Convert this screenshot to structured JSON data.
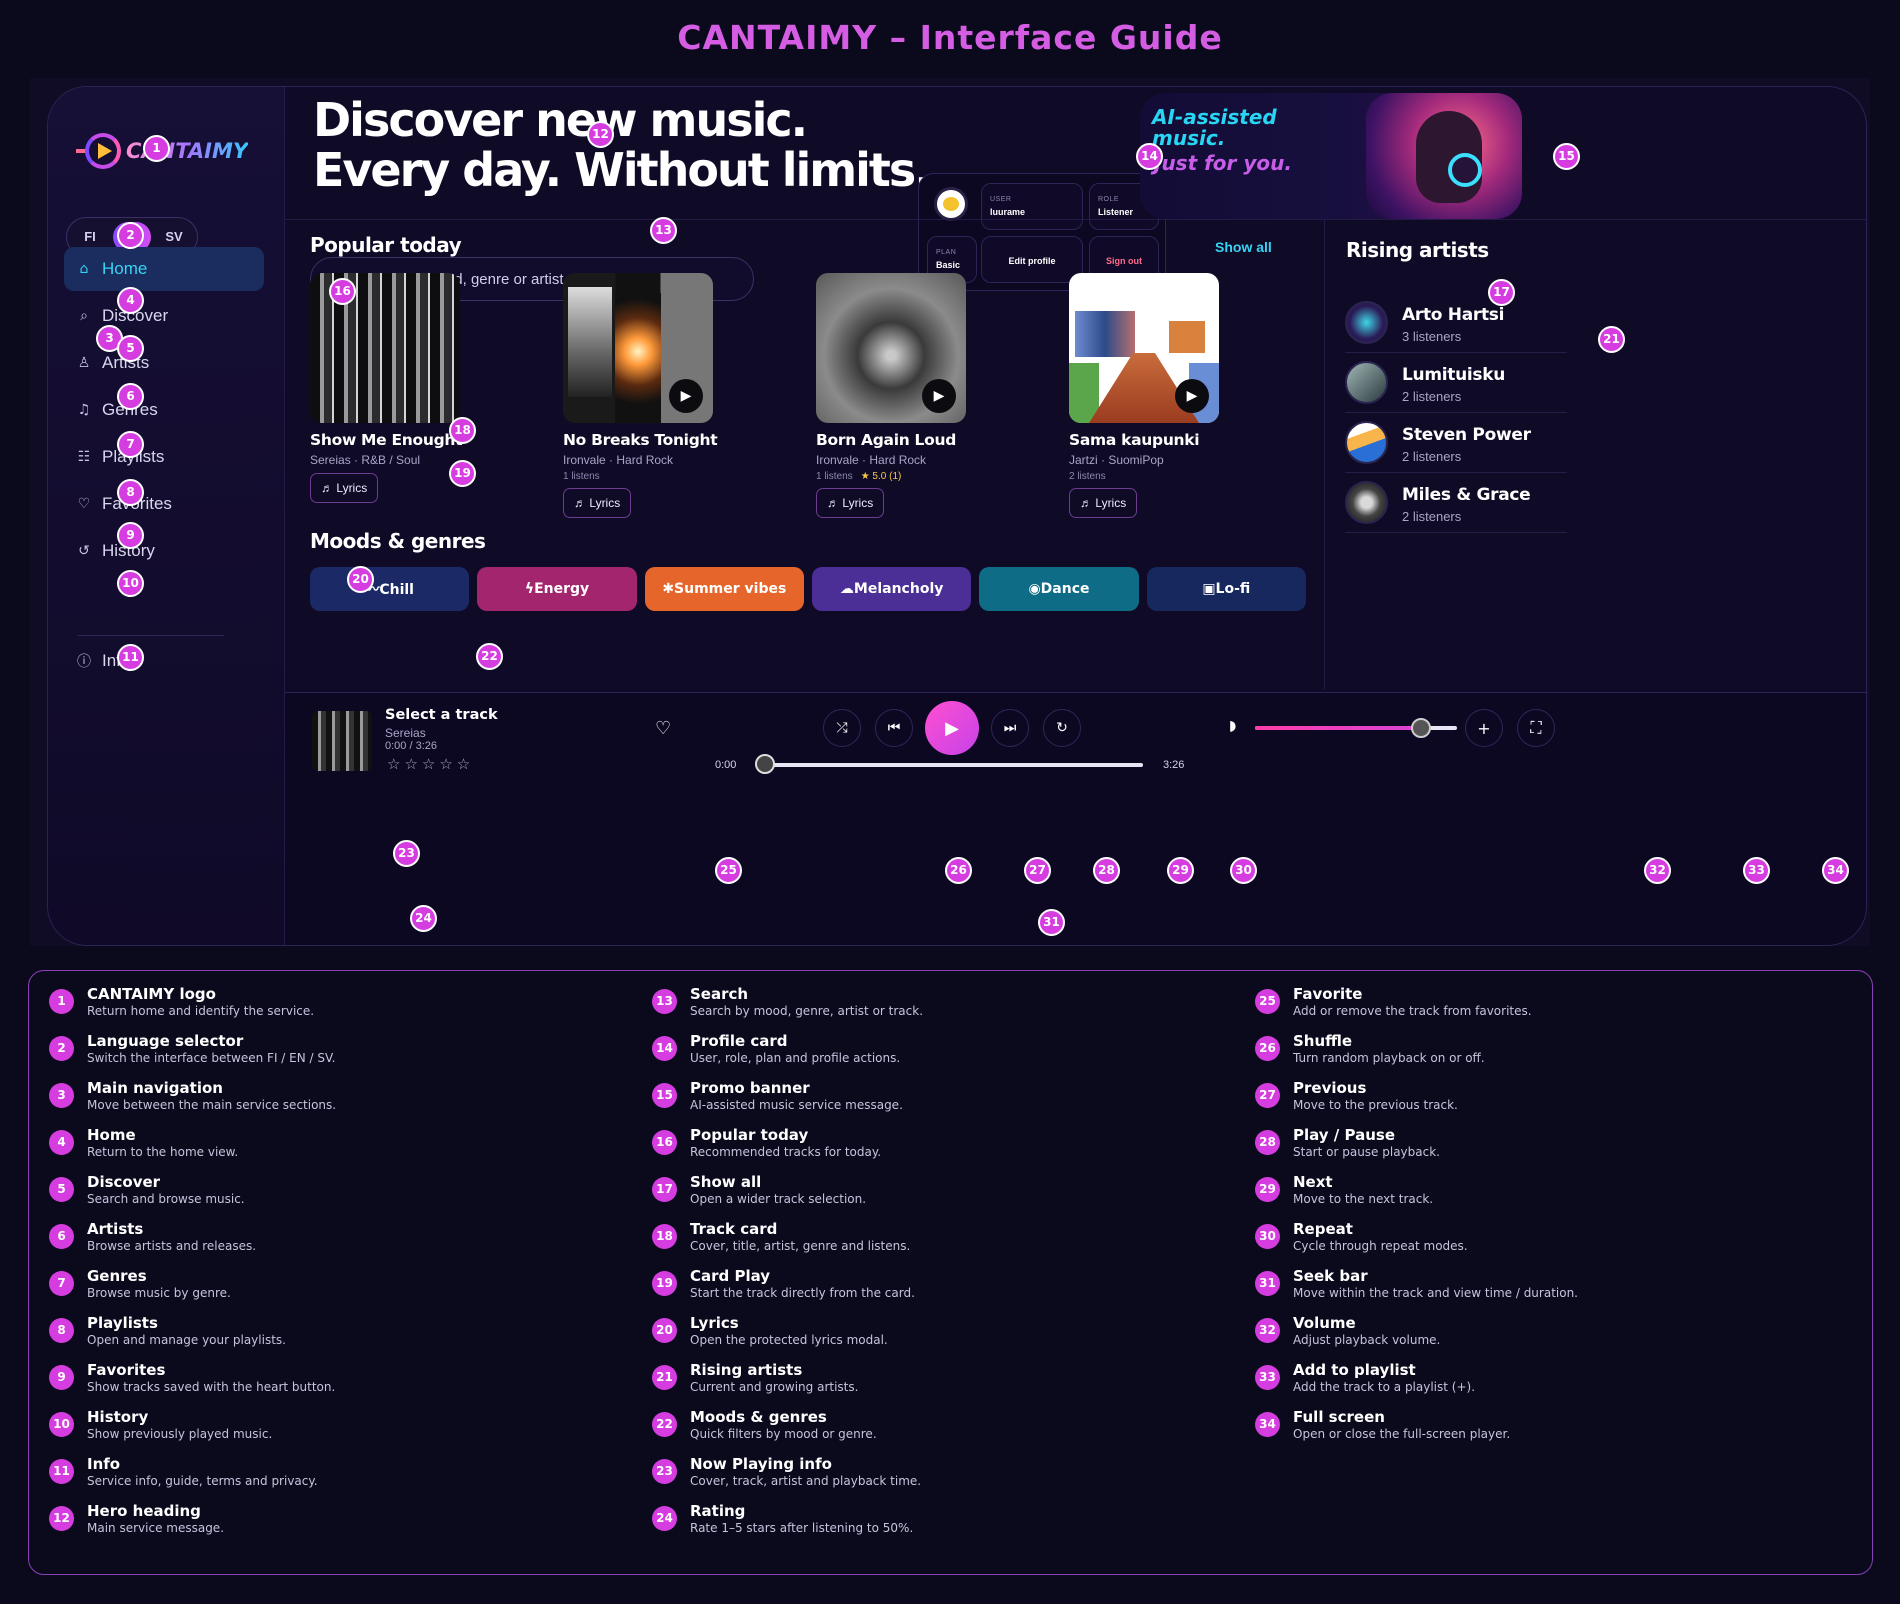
{
  "page_title": "CANTAIMY – Interface Guide",
  "app": {
    "logo_text": "CANTAIMY",
    "languages": [
      "FI",
      "EN",
      "SV"
    ],
    "active_language": "EN",
    "nav": [
      {
        "label": "Home",
        "icon": "home-icon",
        "glyph": "⌂",
        "active": true
      },
      {
        "label": "Discover",
        "icon": "search-icon",
        "glyph": "⌕"
      },
      {
        "label": "Artists",
        "icon": "person-icon",
        "glyph": "♙"
      },
      {
        "label": "Genres",
        "icon": "music-note-icon",
        "glyph": "♫"
      },
      {
        "label": "Playlists",
        "icon": "list-icon",
        "glyph": "☷"
      },
      {
        "label": "Favorites",
        "icon": "heart-icon",
        "glyph": "♡"
      },
      {
        "label": "History",
        "icon": "history-icon",
        "glyph": "↺"
      }
    ],
    "info": {
      "label": "Info",
      "icon": "info-icon",
      "glyph": "ⓘ"
    },
    "hero": {
      "line1": "Discover new music.",
      "line2": "Every day. Without limits."
    },
    "search": {
      "placeholder": "Search by mood, genre or artist...",
      "icon": "search-icon"
    },
    "profile": {
      "user_label": "USER",
      "user_value": "luurame",
      "role_label": "ROLE",
      "role_value": "Listener",
      "plan_label": "PLAN",
      "plan_value": "Basic",
      "edit": "Edit profile",
      "signout": "Sign out"
    },
    "promo": {
      "line1": "AI-assisted music.",
      "line2": "Just for you."
    },
    "popular": {
      "title": "Popular today",
      "show_all": "Show all",
      "tracks": [
        {
          "title": "Show Me Enought",
          "meta": "Sereias · R&B / Soul",
          "listens": "",
          "rating": "",
          "lyrics": "♬ Lyrics"
        },
        {
          "title": "No Breaks Tonight",
          "meta": "Ironvale · Hard Rock",
          "listens": "1 listens",
          "rating": "",
          "lyrics": "♬ Lyrics"
        },
        {
          "title": "Born Again Loud",
          "meta": "Ironvale · Hard Rock",
          "listens": "1 listens",
          "rating": "★ 5.0 (1)",
          "lyrics": "♬ Lyrics"
        },
        {
          "title": "Sama kaupunki",
          "meta": "Jartzi · SuomiPop",
          "listens": "2 listens",
          "rating": "",
          "lyrics": "♬ Lyrics"
        }
      ]
    },
    "moods": {
      "title": "Moods & genres",
      "items": [
        {
          "label": "〰Chill",
          "color": "#1b2a66"
        },
        {
          "label": "ϟEnergy",
          "color": "#a3256e"
        },
        {
          "label": "✱Summer vibes",
          "color": "#e5652a"
        },
        {
          "label": "☁Melancholy",
          "color": "#4c2f96"
        },
        {
          "label": "◉Dance",
          "color": "#0e6c86"
        },
        {
          "label": "▣Lo-fi",
          "color": "#17285e"
        }
      ]
    },
    "rising": {
      "title": "Rising artists",
      "artists": [
        {
          "name": "Arto Hartsi",
          "listeners": "3 listeners"
        },
        {
          "name": "Lumituisku",
          "listeners": "2 listeners"
        },
        {
          "name": "Steven Power",
          "listeners": "2 listeners"
        },
        {
          "name": "Miles & Grace",
          "listeners": "2 listeners"
        }
      ]
    },
    "player": {
      "title": "Select a track",
      "artist": "Sereias",
      "time": "0:00 / 3:26",
      "stars": "☆☆☆☆☆",
      "elapsed": "0:00",
      "duration": "3:26",
      "progress": 0,
      "volume": 0.82
    }
  },
  "badges": [
    "1",
    "2",
    "3",
    "4",
    "5",
    "6",
    "7",
    "8",
    "9",
    "10",
    "11",
    "12",
    "13",
    "14",
    "15",
    "16",
    "17",
    "18",
    "19",
    "20",
    "21",
    "22",
    "23",
    "24",
    "25",
    "26",
    "27",
    "28",
    "29",
    "30",
    "31",
    "32",
    "33",
    "34"
  ],
  "legend": [
    {
      "n": "1",
      "title": "CANTAIMY logo",
      "desc": "Return home and identify the service."
    },
    {
      "n": "2",
      "title": "Language selector",
      "desc": "Switch the interface between FI / EN / SV."
    },
    {
      "n": "3",
      "title": "Main navigation",
      "desc": "Move between the main service sections."
    },
    {
      "n": "4",
      "title": "Home",
      "desc": "Return to the home view."
    },
    {
      "n": "5",
      "title": "Discover",
      "desc": "Search and browse music."
    },
    {
      "n": "6",
      "title": "Artists",
      "desc": "Browse artists and releases."
    },
    {
      "n": "7",
      "title": "Genres",
      "desc": "Browse music by genre."
    },
    {
      "n": "8",
      "title": "Playlists",
      "desc": "Open and manage your playlists."
    },
    {
      "n": "9",
      "title": "Favorites",
      "desc": "Show tracks saved with the heart button."
    },
    {
      "n": "10",
      "title": "History",
      "desc": "Show previously played music."
    },
    {
      "n": "11",
      "title": "Info",
      "desc": "Service info, guide, terms and privacy."
    },
    {
      "n": "12",
      "title": "Hero heading",
      "desc": "Main service message."
    },
    {
      "n": "13",
      "title": "Search",
      "desc": "Search by mood, genre, artist or track."
    },
    {
      "n": "14",
      "title": "Profile card",
      "desc": "User, role, plan and profile actions."
    },
    {
      "n": "15",
      "title": "Promo banner",
      "desc": "AI-assisted music service message."
    },
    {
      "n": "16",
      "title": "Popular today",
      "desc": "Recommended tracks for today."
    },
    {
      "n": "17",
      "title": "Show all",
      "desc": "Open a wider track selection."
    },
    {
      "n": "18",
      "title": "Track card",
      "desc": "Cover, title, artist, genre and listens."
    },
    {
      "n": "19",
      "title": "Card Play",
      "desc": "Start the track directly from the card."
    },
    {
      "n": "20",
      "title": "Lyrics",
      "desc": "Open the protected lyrics modal."
    },
    {
      "n": "21",
      "title": "Rising artists",
      "desc": "Current and growing artists."
    },
    {
      "n": "22",
      "title": "Moods & genres",
      "desc": "Quick filters by mood or genre."
    },
    {
      "n": "23",
      "title": "Now Playing info",
      "desc": "Cover, track, artist and playback time."
    },
    {
      "n": "24",
      "title": "Rating",
      "desc": "Rate 1–5 stars after listening to 50%."
    },
    {
      "n": "25",
      "title": "Favorite",
      "desc": "Add or remove the track from favorites."
    },
    {
      "n": "26",
      "title": "Shuffle",
      "desc": "Turn random playback on or off."
    },
    {
      "n": "27",
      "title": "Previous",
      "desc": "Move to the previous track."
    },
    {
      "n": "28",
      "title": "Play / Pause",
      "desc": "Start or pause playback."
    },
    {
      "n": "29",
      "title": "Next",
      "desc": "Move to the next track."
    },
    {
      "n": "30",
      "title": "Repeat",
      "desc": "Cycle through repeat modes."
    },
    {
      "n": "31",
      "title": "Seek bar",
      "desc": "Move within the track and view time / duration."
    },
    {
      "n": "32",
      "title": "Volume",
      "desc": "Adjust playback volume."
    },
    {
      "n": "33",
      "title": "Add to playlist",
      "desc": "Add the track to a playlist (+)."
    },
    {
      "n": "34",
      "title": "Full screen",
      "desc": "Open or close the full-screen player."
    }
  ]
}
